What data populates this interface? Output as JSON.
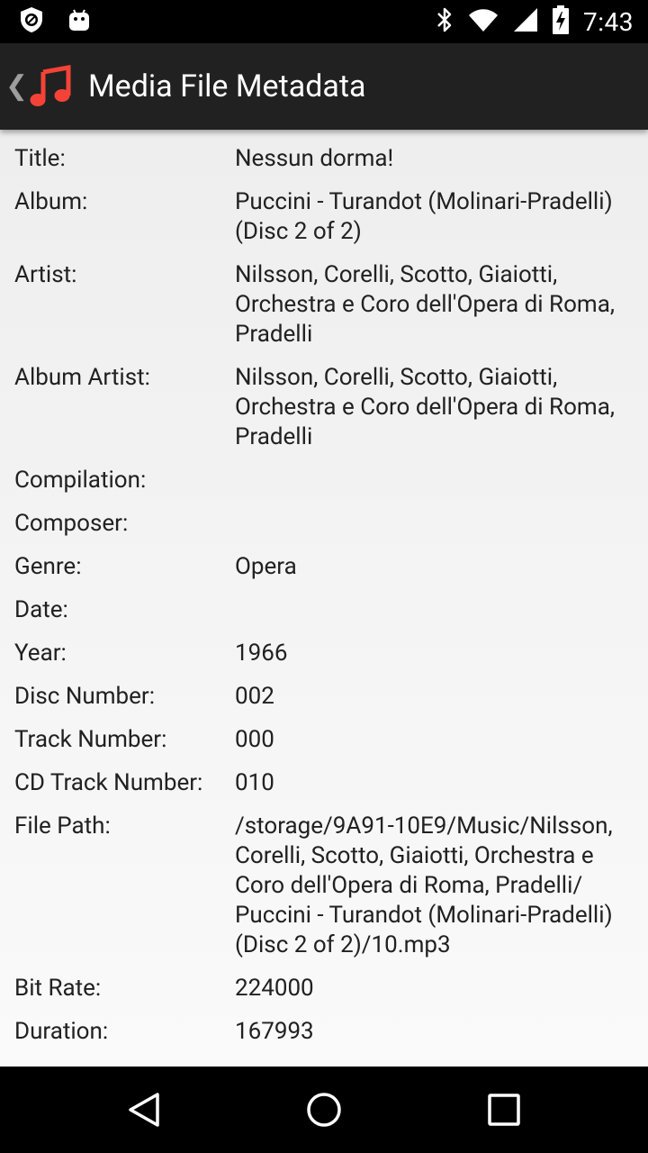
{
  "status_bar": {
    "time": "7:43",
    "left_icons": [
      "shield-icon",
      "android-icon"
    ],
    "right_icons": [
      "bluetooth-icon",
      "wifi-icon",
      "cell-signal-icon",
      "battery-charging-icon"
    ]
  },
  "action_bar": {
    "title": "Media File Metadata",
    "icon": "music-note-icon",
    "icon_color": "#f44336"
  },
  "metadata": [
    {
      "label": "Title:",
      "value": "Nessun dorma!"
    },
    {
      "label": "Album:",
      "value": "Puccini - Turandot (Molinari-Pradelli)\n(Disc 2 of 2)"
    },
    {
      "label": "Artist:",
      "value": "Nilsson, Corelli, Scotto, Giaiotti,\nOrchestra e Coro dell'Opera di Roma,\nPradelli"
    },
    {
      "label": "Album Artist:",
      "value": "Nilsson, Corelli, Scotto, Giaiotti,\nOrchestra e Coro dell'Opera di Roma,\nPradelli"
    },
    {
      "label": "Compilation:",
      "value": ""
    },
    {
      "label": "Composer:",
      "value": ""
    },
    {
      "label": "Genre:",
      "value": "Opera"
    },
    {
      "label": "Date:",
      "value": ""
    },
    {
      "label": "Year:",
      "value": "1966"
    },
    {
      "label": "Disc Number:",
      "value": "002"
    },
    {
      "label": "Track Number:",
      "value": "000"
    },
    {
      "label": "CD Track Number:",
      "value": "010"
    },
    {
      "label": "File Path:",
      "value": "/storage/9A91-10E9/Music/Nilsson,\nCorelli, Scotto, Giaiotti, Orchestra e\nCoro dell'Opera di Roma, Pradelli/\nPuccini - Turandot (Molinari-Pradelli)\n(Disc 2 of 2)/10.mp3"
    },
    {
      "label": "Bit Rate:",
      "value": "224000"
    },
    {
      "label": "Duration:",
      "value": "167993"
    }
  ],
  "nav_bar": {
    "buttons": [
      "back-icon",
      "home-icon",
      "recents-icon"
    ]
  }
}
